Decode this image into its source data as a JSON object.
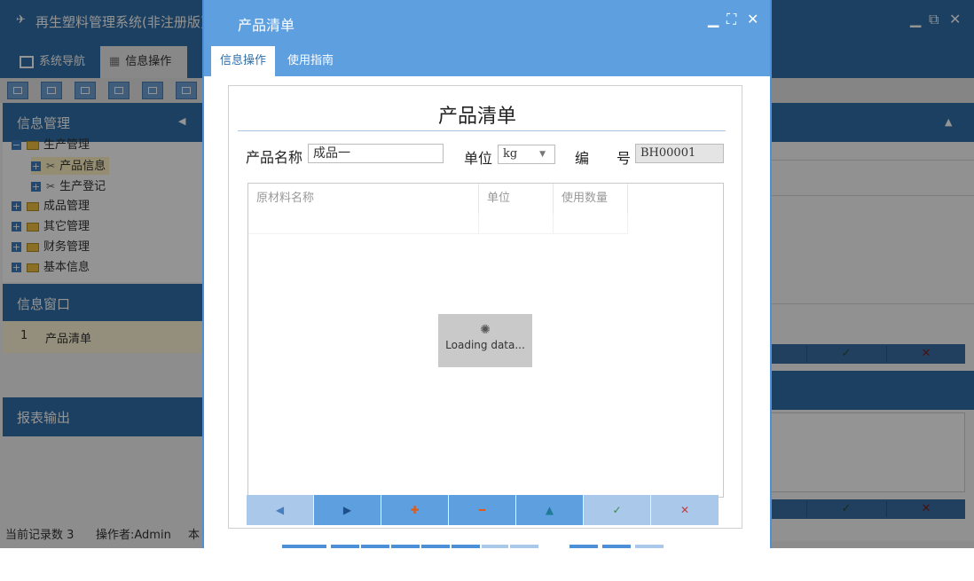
{
  "app": {
    "title": "再生塑料管理系统(非注册版)",
    "tabs": [
      {
        "label": "系统导航"
      },
      {
        "label": "信息操作"
      }
    ],
    "panels": {
      "info_management": "信息管理",
      "info_window": "信息窗口",
      "report_output": "报表输出"
    },
    "tree": [
      {
        "label": "生产管理",
        "type": "folder"
      },
      {
        "label": "产品信息",
        "type": "tool",
        "selected": true
      },
      {
        "label": "生产登记",
        "type": "tool"
      },
      {
        "label": "成品管理",
        "type": "folder"
      },
      {
        "label": "其它管理",
        "type": "folder"
      },
      {
        "label": "财务管理",
        "type": "folder"
      },
      {
        "label": "基本信息",
        "type": "folder"
      }
    ],
    "window_list": [
      {
        "index": "1",
        "label": "产品清单"
      }
    ],
    "status": {
      "records": "当前记录数 3",
      "operator": "操作者:Admin",
      "extra": "本"
    },
    "icons": {
      "check": "✓",
      "cross": "✕"
    }
  },
  "modal": {
    "title": "产品清单",
    "tabs": [
      {
        "label": "信息操作"
      },
      {
        "label": "使用指南"
      }
    ],
    "form": {
      "heading": "产品清单",
      "product_name_label": "产品名称",
      "product_name_value": "成品一",
      "unit_label": "单位",
      "unit_value": "kg",
      "code_label_1": "编",
      "code_label_2": "号",
      "code_value": "BH00001"
    },
    "grid": {
      "columns": [
        "原材料名称",
        "单位",
        "使用数量"
      ],
      "loading_text": "Loading data..."
    },
    "nav_buttons": [
      {
        "name": "prev-icon",
        "glyph": "◀"
      },
      {
        "name": "next-icon",
        "glyph": "▶"
      },
      {
        "name": "add-icon",
        "glyph": "✚"
      },
      {
        "name": "remove-icon",
        "glyph": "━"
      },
      {
        "name": "up-icon",
        "glyph": "▲"
      },
      {
        "name": "confirm-icon",
        "glyph": "✓"
      },
      {
        "name": "cancel-icon",
        "glyph": "✕"
      }
    ],
    "colors": {
      "header": "#5d9fdf",
      "accent": "#2f6ea8"
    }
  }
}
